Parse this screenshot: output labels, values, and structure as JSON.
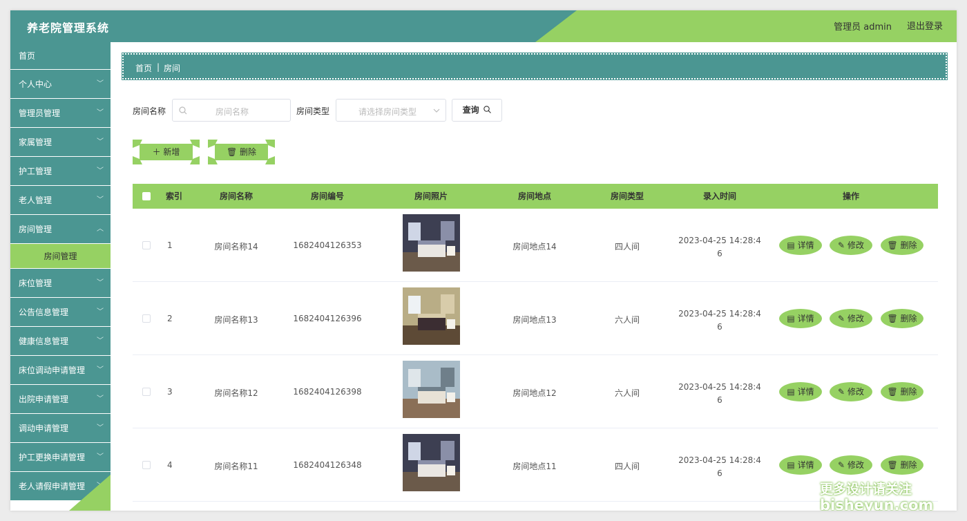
{
  "header": {
    "app_title": "养老院管理系统",
    "user_label": "管理员 admin",
    "logout": "退出登录"
  },
  "sidebar": {
    "items": [
      {
        "label": "首页"
      },
      {
        "label": "个人中心"
      },
      {
        "label": "管理员管理"
      },
      {
        "label": "家属管理"
      },
      {
        "label": "护工管理"
      },
      {
        "label": "老人管理"
      },
      {
        "label": "房间管理"
      },
      {
        "label": "床位管理"
      },
      {
        "label": "公告信息管理"
      },
      {
        "label": "健康信息管理"
      },
      {
        "label": "床位调动申请管理"
      },
      {
        "label": "出院申请管理"
      },
      {
        "label": "调动申请管理"
      },
      {
        "label": "护工更换申请管理"
      },
      {
        "label": "老人请假申请管理"
      }
    ],
    "active_sub": "房间管理"
  },
  "breadcrumb": {
    "home": "首页",
    "separator": "|",
    "current": "房间"
  },
  "search": {
    "name_label": "房间名称",
    "name_placeholder": "房间名称",
    "type_label": "房间类型",
    "type_placeholder": "请选择房间类型",
    "query_label": "查询"
  },
  "toolbar": {
    "add_label": "新增",
    "delete_label": "删除"
  },
  "table": {
    "headers": [
      "索引",
      "房间名称",
      "房间编号",
      "房间照片",
      "房间地点",
      "房间类型",
      "录入时间",
      "操作"
    ],
    "rows": [
      {
        "index": "1",
        "name": "房间名称14",
        "code": "1682404126353",
        "location": "房间地点14",
        "type": "四人间",
        "time_l1": "2023-04-25 14:28:4",
        "time_l2": "6"
      },
      {
        "index": "2",
        "name": "房间名称13",
        "code": "1682404126396",
        "location": "房间地点13",
        "type": "六人间",
        "time_l1": "2023-04-25 14:28:4",
        "time_l2": "6"
      },
      {
        "index": "3",
        "name": "房间名称12",
        "code": "1682404126398",
        "location": "房间地点12",
        "type": "六人间",
        "time_l1": "2023-04-25 14:28:4",
        "time_l2": "6"
      },
      {
        "index": "4",
        "name": "房间名称11",
        "code": "1682404126348",
        "location": "房间地点11",
        "type": "四人间",
        "time_l1": "2023-04-25 14:28:4",
        "time_l2": "6"
      }
    ],
    "actions": {
      "detail": "详情",
      "edit": "修改",
      "delete": "删除"
    }
  },
  "watermark": {
    "line1": "更多设计请关注",
    "line2": "bisheyun.com"
  },
  "colors": {
    "teal": "#4b9692",
    "green": "#96d163"
  }
}
